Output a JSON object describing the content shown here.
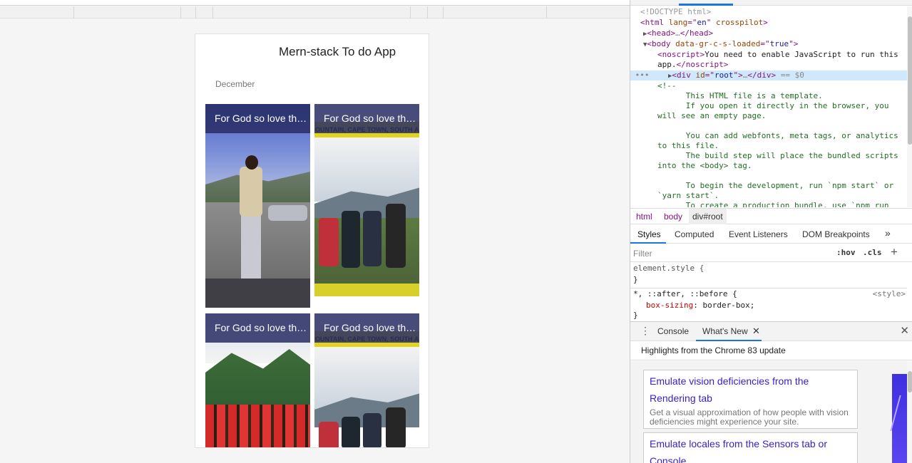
{
  "app": {
    "title": "Mern-stack To do App",
    "month": "December",
    "tiles": [
      {
        "title": "For God so love the world",
        "tape_text": ""
      },
      {
        "title": "For God so love the world",
        "tape_text": "OUNTAIN, CAPE TOWN, SOUTH A"
      },
      {
        "title": "For God so love the world",
        "tape_text": ""
      },
      {
        "title": "For God so love the world",
        "tape_text": "OUNTAIN, CAPE TOWN, SOUTH A"
      }
    ]
  },
  "devtools": {
    "elements": {
      "doctype": "<!DOCTYPE html>",
      "html_tag": "html",
      "html_attrs": [
        {
          "name": "lang",
          "value": "en"
        },
        {
          "name": "crosspilot",
          "value": ""
        }
      ],
      "head": "head",
      "body_attr_name": "data-gr-c-s-loaded",
      "body_attr_value": "true",
      "noscript_text": "You need to enable JavaScript to run this",
      "noscript_text2": "app.",
      "root_div_id": "root",
      "selected_suffix": " == $0",
      "comment_lines": [
        "<!--",
        "      This HTML file is a template.",
        "      If you open it directly in the browser, you",
        "will see an empty page.",
        "",
        "      You can add webfonts, meta tags, or analytics",
        "to this file.",
        "      The build step will place the bundled scripts",
        "into the <body> tag.",
        "",
        "      To begin the development, run `npm start` or",
        "`yarn start`.",
        "      To create a production bundle, use `npm run"
      ]
    },
    "breadcrumbs": [
      "html",
      "body",
      "div#root"
    ],
    "panel_tabs": [
      "Styles",
      "Computed",
      "Event Listeners",
      "DOM Breakpoints",
      "»"
    ],
    "filter_placeholder": "Filter",
    "hov": ":hov",
    "cls": ".cls",
    "styles": {
      "element_style": "element.style {",
      "close_brace": "}",
      "universal_selector": "*, ::after, ::before {",
      "source": "<style>",
      "prop_name": "box-sizing",
      "prop_value": "border-box;"
    },
    "drawer_tabs": {
      "console": "Console",
      "whats_new": "What's New"
    },
    "highlights_text": "Highlights from the Chrome 83 update",
    "news": [
      {
        "title": "Emulate vision deficiencies from the Rendering tab",
        "desc": "Get a visual approximation of how people with vision deficiencies might experience your site."
      },
      {
        "title": "Emulate locales from the Sensors tab or Console",
        "desc": ""
      }
    ]
  },
  "colors": {
    "tag": "#881280",
    "attr": "#994500",
    "value": "#1a1aa6",
    "comment": "#236e25",
    "accent": "#1a73e8",
    "link": "#3a1ec8"
  }
}
